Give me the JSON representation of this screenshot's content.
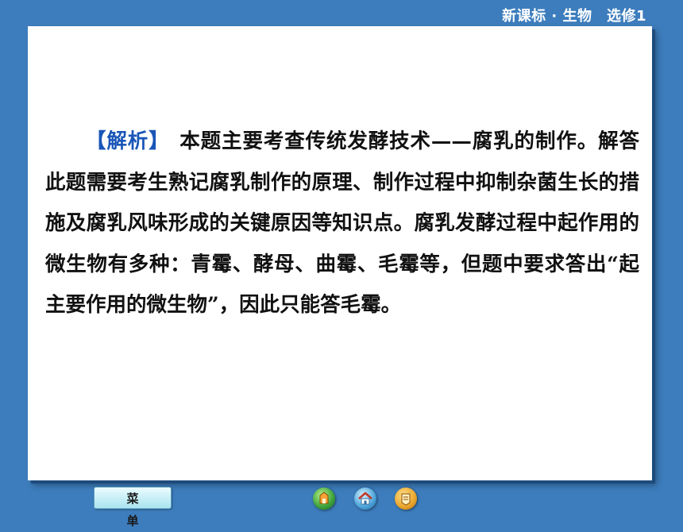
{
  "header": {
    "course": "新课标 · 生物　选修1"
  },
  "content": {
    "tag": "【解析】",
    "text": "本题主要考查传统发酵技术——腐乳的制作。解答此题需要考生熟记腐乳制作的原理、制作过程中抑制杂菌生长的措施及腐乳风味形成的关键原因等知识点。腐乳发酵过程中起作用的微生物有多种：青霉、酵母、曲霉、毛霉等，但题中要求答出“起主要作用的微生物”，因此只能答毛霉。"
  },
  "footer": {
    "menu_label": "菜单"
  },
  "nav_icons": [
    "previous-icon",
    "home-icon",
    "next-icon"
  ],
  "colors": {
    "background": "#3d7dbd",
    "tag": "#1a56b8",
    "text": "#111111"
  }
}
